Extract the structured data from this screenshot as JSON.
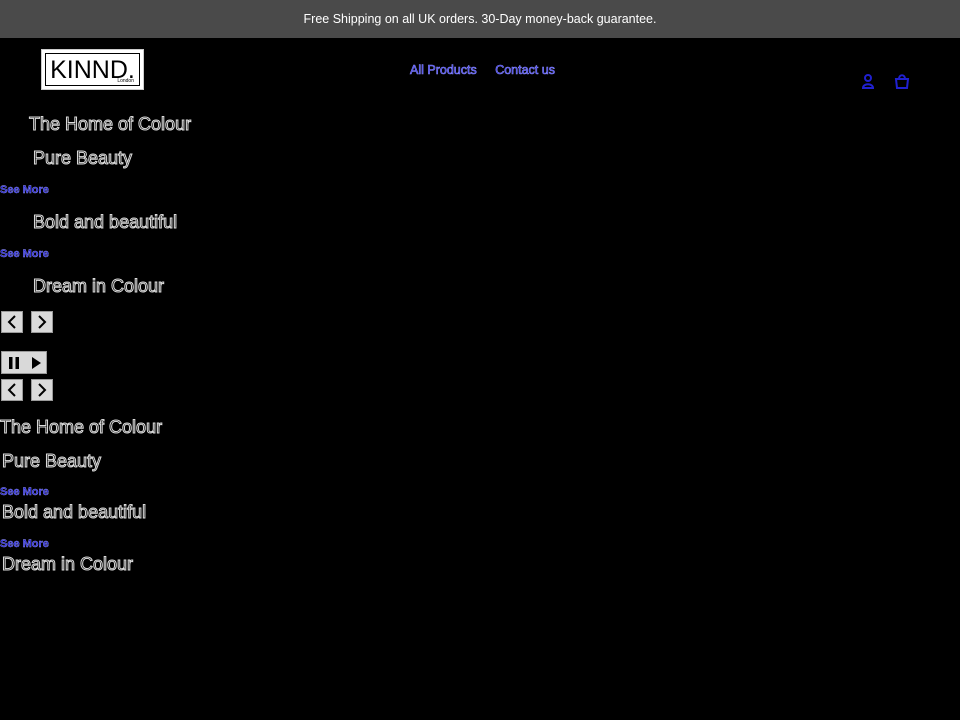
{
  "announcement": "Free Shipping on all UK orders. 30-Day money-back guarantee.",
  "logo": {
    "word": "KINND.",
    "sub": "London"
  },
  "nav": [
    {
      "label": "All Products"
    },
    {
      "label": "Contact us"
    }
  ],
  "header_icons": [
    "account-icon",
    "cart-icon"
  ],
  "slideshow_primary": {
    "slides": [
      {
        "title": "The Home of Colour"
      },
      {
        "title": "Pure Beauty",
        "link": "See More"
      },
      {
        "title": "Bold and beautiful",
        "link": "See More"
      },
      {
        "title": "Dream in Colour"
      }
    ]
  },
  "slideshow_secondary": {
    "slides": [
      {
        "title": "The Home of Colour"
      },
      {
        "title": "Pure Beauty",
        "link": "See More"
      },
      {
        "title": "Bold and beautiful",
        "link": "See More"
      },
      {
        "title": "Dream in Colour"
      }
    ]
  },
  "colors": {
    "background": "#000000",
    "announcement_bg": "#4a4a4a",
    "link": "#2b2bd6",
    "control_bg": "#d9d9d9"
  }
}
